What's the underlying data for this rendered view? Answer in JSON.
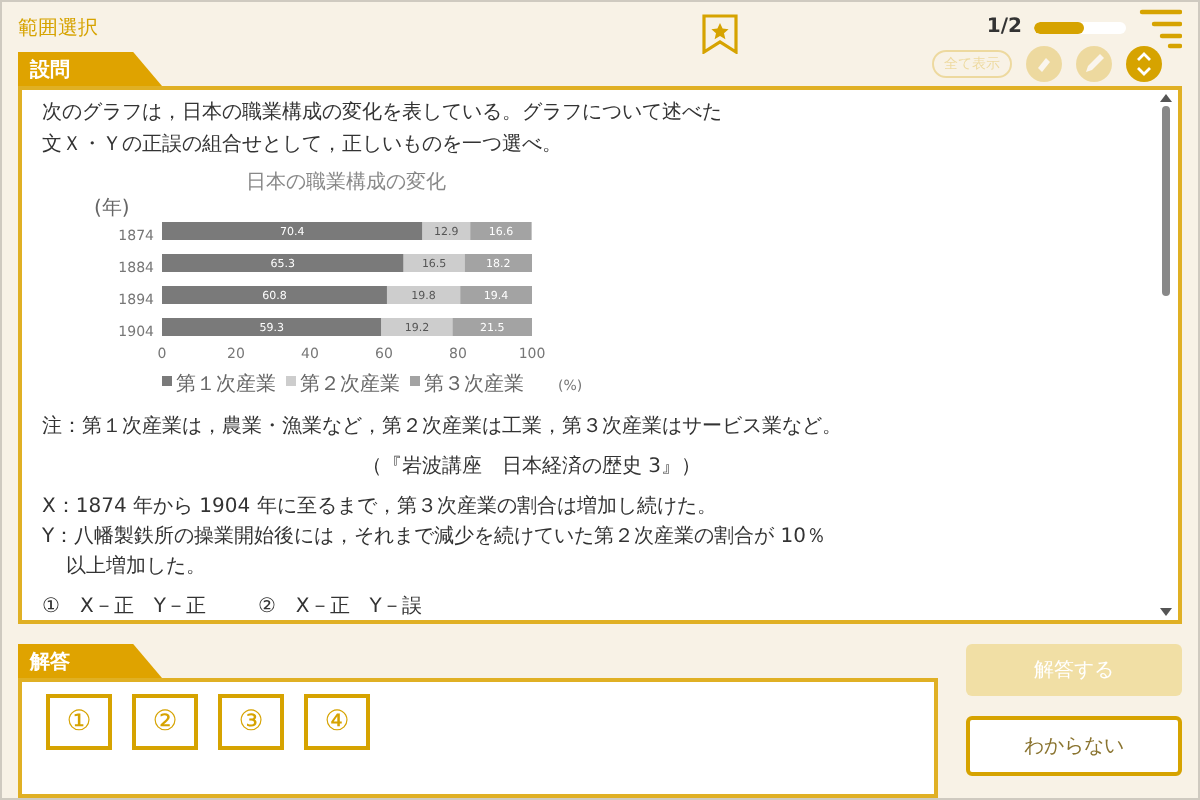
{
  "header": {
    "title": "範囲選択",
    "page": "1/2",
    "progress": {
      "level": 0.55
    }
  },
  "question": {
    "tab": "設問",
    "show_all": {
      "label": "全て表示",
      "disabled": true
    },
    "tools": [
      {
        "kind": "marker",
        "disabled": true
      },
      {
        "kind": "pencil",
        "disabled": true
      },
      {
        "kind": "expand",
        "disabled": false
      }
    ],
    "prompt": "次のグラフは，日本の職業構成の変化を表している。グラフについて述べた文Ｘ・Ｙの正誤の組合せとして，正しいものを一つ選べ。",
    "chart_data": {
      "type": "bar",
      "orientation": "horizontal",
      "stacked": true,
      "title": "日本の職業構成の変化",
      "ylabel": "(年)",
      "xlabel": "(%)",
      "categories": [
        "1874",
        "1884",
        "1894",
        "1904"
      ],
      "xlim": [
        0,
        100
      ],
      "legend": true,
      "xticks": [
        0,
        20,
        40,
        60,
        80,
        100
      ],
      "data_labels": true,
      "series": [
        {
          "name": "第１次産業",
          "color": "#7a7a7a",
          "values": [
            70.4,
            65.3,
            60.8,
            59.3
          ]
        },
        {
          "name": "第２次産業",
          "color": "#cdcdcd",
          "values": [
            12.9,
            16.5,
            19.8,
            19.2
          ]
        },
        {
          "name": "第３次産業",
          "color": "#a3a3a3",
          "values": [
            16.6,
            18.2,
            19.4,
            21.5
          ]
        }
      ]
    },
    "note": "注：第１次産業は，農業・漁業など，第２次産業は工業，第３次産業はサービス業など。",
    "source": "（『岩波講座　日本経済の歴史 3』）",
    "statements": [
      "X：1874 年から 1904 年に至るまで，第３次産業の割合は増加し続けた。",
      "Y：八幡製鉄所の操業開始後には，それまで減少を続けていた第２次産業の割合が 10％以上増加した。"
    ],
    "options": [
      "①　X－正　Y－正",
      "②　X－正　Y－誤"
    ]
  },
  "answer": {
    "tab": "解答",
    "choices": [
      {
        "label": "①",
        "selected": false
      },
      {
        "label": "②",
        "selected": false
      },
      {
        "label": "③",
        "selected": false
      },
      {
        "label": "④",
        "selected": false
      }
    ],
    "submit": {
      "label": "解答する",
      "disabled": true
    },
    "dont_know": "わからない"
  }
}
